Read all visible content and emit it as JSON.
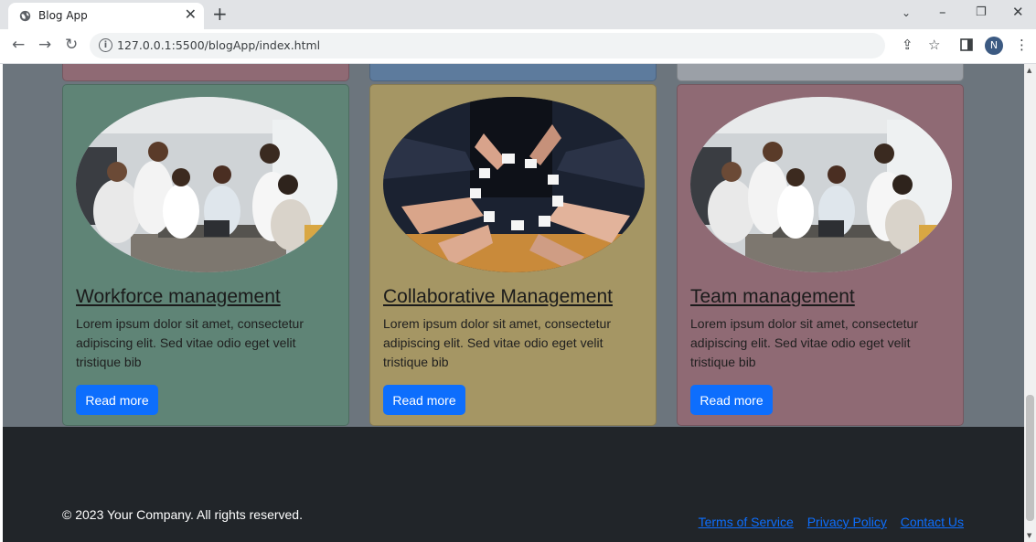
{
  "browser": {
    "tab_title": "Blog App",
    "url": "127.0.0.1:5500/blogApp/index.html",
    "profile_initial": "N"
  },
  "cards": [
    {
      "title": "Workforce management",
      "text": "Lorem ipsum dolor sit amet, consectetur adipiscing elit. Sed vitae odio eget velit tristique bib",
      "button": "Read more",
      "image": "office-team-meeting-photo",
      "bg_color": "#5f8476"
    },
    {
      "title": "Collaborative Management",
      "text": "Lorem ipsum dolor sit amet, consectetur adipiscing elit. Sed vitae odio eget velit tristique bib",
      "button": "Read more",
      "image": "puzzle-pieces-hands-photo",
      "bg_color": "#a59664"
    },
    {
      "title": "Team management",
      "text": "Lorem ipsum dolor sit amet, consectetur adipiscing elit. Sed vitae odio eget velit tristique bib",
      "button": "Read more",
      "image": "office-team-meeting-photo",
      "bg_color": "#8f6a74"
    }
  ],
  "footer": {
    "copyright": "© 2023 Your Company. All rights reserved.",
    "links": [
      "Terms of Service",
      "Privacy Policy",
      "Contact Us"
    ]
  },
  "colors": {
    "page_bg": "#6c757d",
    "footer_bg": "#212529",
    "accent": "#0d6efd"
  }
}
